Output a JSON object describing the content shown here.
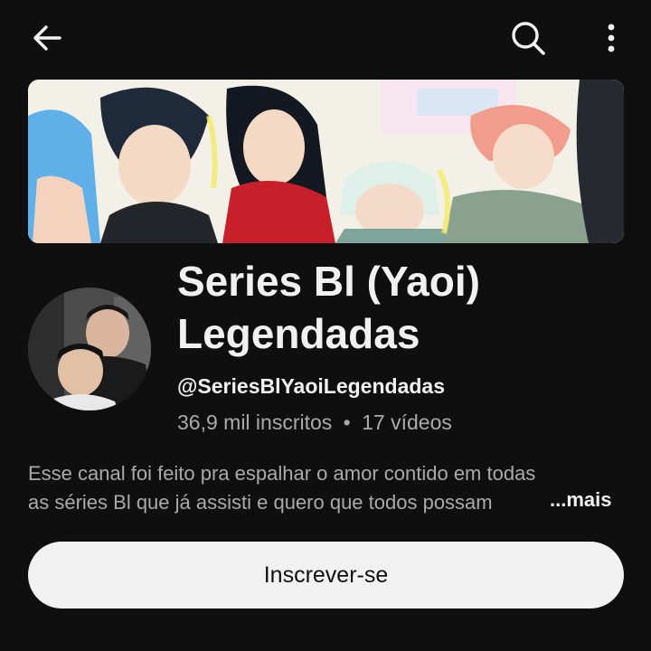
{
  "topbar": {
    "back_icon": "arrow-left-icon",
    "search_icon": "search-icon",
    "more_icon": "more-vertical-icon"
  },
  "banner": {
    "description": "anime-style channel banner artwork"
  },
  "channel": {
    "title_line1": "Series Bl (Yaoi)",
    "title_line2": "Legendadas",
    "handle": "@SeriesBlYaoiLegendadas",
    "subscribers": "36,9 mil inscritos",
    "separator": "•",
    "videos": "17 vídeos"
  },
  "description": {
    "line1": "Esse canal foi feito pra espalhar o amor contido em todas",
    "line2": "as séries Bl que já assisti e quero que todos possam",
    "more_label": "...mais"
  },
  "subscribe": {
    "label": "Inscrever-se"
  },
  "colors": {
    "background": "#0f0f0f",
    "text": "#f1f1f1",
    "secondary_text": "#aaaaaa",
    "button_bg": "#f1f1f1"
  }
}
